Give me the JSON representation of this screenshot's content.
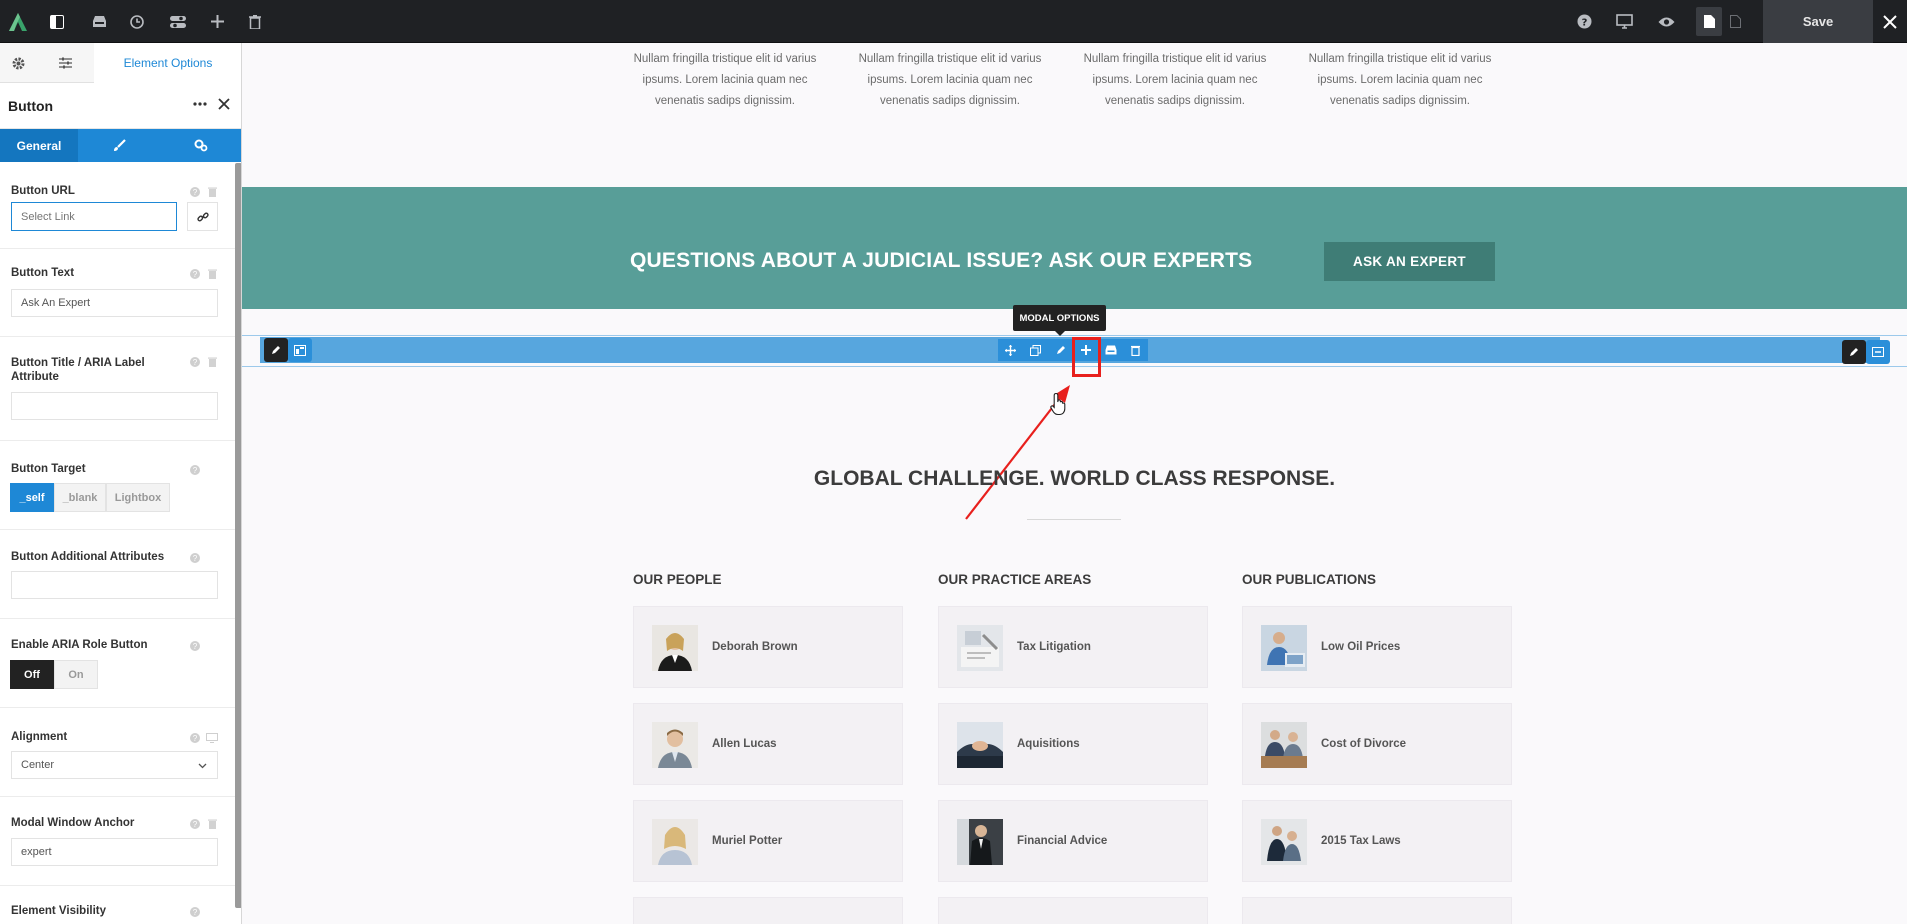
{
  "toolbar": {
    "save_label": "Save",
    "colors": {
      "bg": "#1f2124",
      "logo": "#39a36b"
    }
  },
  "sidebar": {
    "tabs": {
      "options_label": "Element Options"
    },
    "element_title": "Button",
    "subtabs": {
      "general_label": "General"
    },
    "options": {
      "url": {
        "label": "Button URL",
        "placeholder": "Select Link"
      },
      "text": {
        "label": "Button Text",
        "value": "Ask An Expert"
      },
      "title_attr": {
        "label": "Button Title / ARIA Label Attribute",
        "value": ""
      },
      "target": {
        "label": "Button Target",
        "choices": [
          "_self",
          "_blank",
          "Lightbox"
        ],
        "selected": "_self"
      },
      "attributes": {
        "label": "Button Additional Attributes",
        "value": ""
      },
      "aria_role": {
        "label": "Enable ARIA Role Button",
        "choices": [
          "Off",
          "On"
        ],
        "selected": "Off"
      },
      "alignment": {
        "label": "Alignment",
        "value": "Center"
      },
      "anchor": {
        "label": "Modal Window Anchor",
        "value": "expert"
      },
      "visibility": {
        "label": "Element Visibility"
      }
    }
  },
  "canvas": {
    "features": [
      "Nullam fringilla tristique elit id varius ipsums. Lorem lacinia quam nec venenatis sadips dignissim.",
      "Nullam fringilla tristique elit id varius ipsums. Lorem lacinia quam nec venenatis sadips dignissim.",
      "Nullam fringilla tristique elit id varius ipsums. Lorem lacinia quam nec venenatis sadips dignissim.",
      "Nullam fringilla tristique elit id varius ipsums. Lorem lacinia quam nec venenatis sadips dignissim."
    ],
    "cta": {
      "title": "QUESTIONS ABOUT A JUDICIAL ISSUE? ASK OUR EXPERTS",
      "button": "ASK AN EXPERT",
      "color": "#589e98"
    },
    "modal_tooltip": "MODAL OPTIONS",
    "heading": "GLOBAL CHALLENGE. WORLD CLASS RESPONSE.",
    "columns": [
      {
        "title": "OUR PEOPLE",
        "items": [
          "Deborah Brown",
          "Allen Lucas",
          "Muriel Potter"
        ]
      },
      {
        "title": "OUR PRACTICE AREAS",
        "items": [
          "Tax Litigation",
          "Aquisitions",
          "Financial Advice"
        ]
      },
      {
        "title": "OUR PUBLICATIONS",
        "items": [
          "Low Oil Prices",
          "Cost of Divorce",
          "2015 Tax Laws"
        ]
      }
    ]
  }
}
